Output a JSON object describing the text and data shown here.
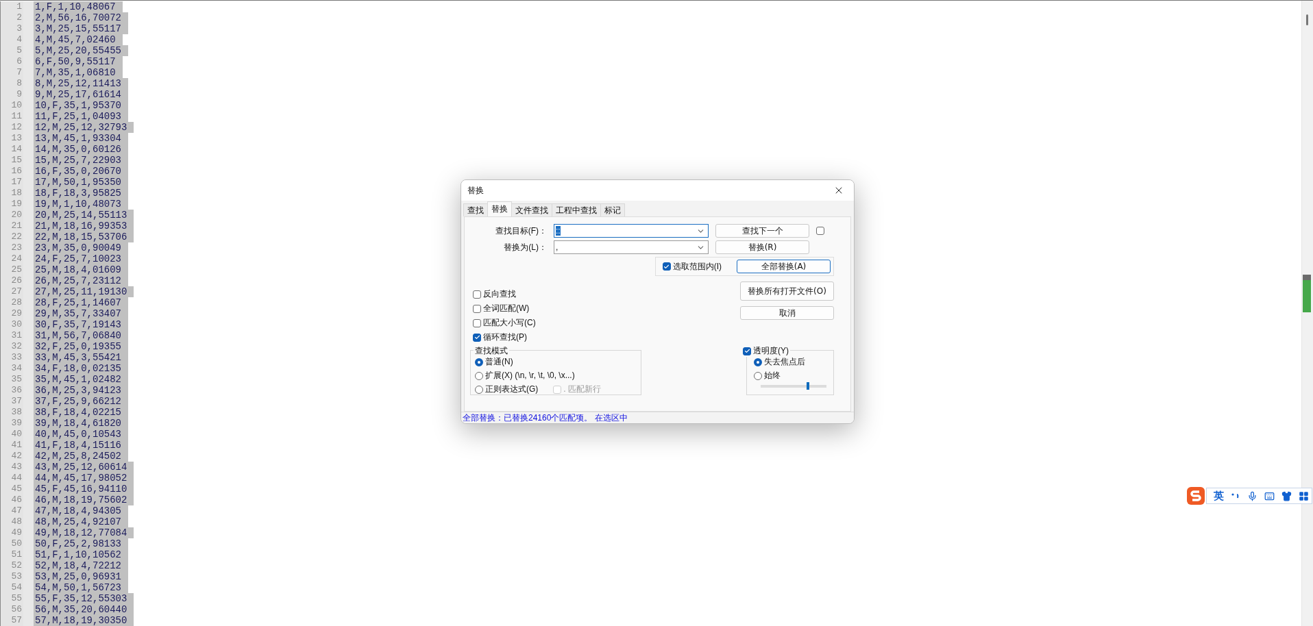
{
  "editor": {
    "selected": true,
    "lines": [
      {
        "number": "1",
        "text": "1,F,1,10,48067"
      },
      {
        "number": "2",
        "text": "2,M,56,16,70072"
      },
      {
        "number": "3",
        "text": "3,M,25,15,55117"
      },
      {
        "number": "4",
        "text": "4,M,45,7,02460"
      },
      {
        "number": "5",
        "text": "5,M,25,20,55455"
      },
      {
        "number": "6",
        "text": "6,F,50,9,55117"
      },
      {
        "number": "7",
        "text": "7,M,35,1,06810"
      },
      {
        "number": "8",
        "text": "8,M,25,12,11413"
      },
      {
        "number": "9",
        "text": "9,M,25,17,61614"
      },
      {
        "number": "10",
        "text": "10,F,35,1,95370"
      },
      {
        "number": "11",
        "text": "11,F,25,1,04093"
      },
      {
        "number": "12",
        "text": "12,M,25,12,32793"
      },
      {
        "number": "13",
        "text": "13,M,45,1,93304"
      },
      {
        "number": "14",
        "text": "14,M,35,0,60126"
      },
      {
        "number": "15",
        "text": "15,M,25,7,22903"
      },
      {
        "number": "16",
        "text": "16,F,35,0,20670"
      },
      {
        "number": "17",
        "text": "17,M,50,1,95350"
      },
      {
        "number": "18",
        "text": "18,F,18,3,95825"
      },
      {
        "number": "19",
        "text": "19,M,1,10,48073"
      },
      {
        "number": "20",
        "text": "20,M,25,14,55113"
      },
      {
        "number": "21",
        "text": "21,M,18,16,99353"
      },
      {
        "number": "22",
        "text": "22,M,18,15,53706"
      },
      {
        "number": "23",
        "text": "23,M,35,0,90049"
      },
      {
        "number": "24",
        "text": "24,F,25,7,10023"
      },
      {
        "number": "25",
        "text": "25,M,18,4,01609"
      },
      {
        "number": "26",
        "text": "26,M,25,7,23112"
      },
      {
        "number": "27",
        "text": "27,M,25,11,19130"
      },
      {
        "number": "28",
        "text": "28,F,25,1,14607"
      },
      {
        "number": "29",
        "text": "29,M,35,7,33407"
      },
      {
        "number": "30",
        "text": "30,F,35,7,19143"
      },
      {
        "number": "31",
        "text": "31,M,56,7,06840"
      },
      {
        "number": "32",
        "text": "32,F,25,0,19355"
      },
      {
        "number": "33",
        "text": "33,M,45,3,55421"
      },
      {
        "number": "34",
        "text": "34,F,18,0,02135"
      },
      {
        "number": "35",
        "text": "35,M,45,1,02482"
      },
      {
        "number": "36",
        "text": "36,M,25,3,94123"
      },
      {
        "number": "37",
        "text": "37,F,25,9,66212"
      },
      {
        "number": "38",
        "text": "38,F,18,4,02215"
      },
      {
        "number": "39",
        "text": "39,M,18,4,61820"
      },
      {
        "number": "40",
        "text": "40,M,45,0,10543"
      },
      {
        "number": "41",
        "text": "41,F,18,4,15116"
      },
      {
        "number": "42",
        "text": "42,M,25,8,24502"
      },
      {
        "number": "43",
        "text": "43,M,25,12,60614"
      },
      {
        "number": "44",
        "text": "44,M,45,17,98052"
      },
      {
        "number": "45",
        "text": "45,F,45,16,94110"
      },
      {
        "number": "46",
        "text": "46,M,18,19,75602"
      },
      {
        "number": "47",
        "text": "47,M,18,4,94305"
      },
      {
        "number": "48",
        "text": "48,M,25,4,92107"
      },
      {
        "number": "49",
        "text": "49,M,18,12,77084"
      },
      {
        "number": "50",
        "text": "50,F,25,2,98133"
      },
      {
        "number": "51",
        "text": "51,F,1,10,10562"
      },
      {
        "number": "52",
        "text": "52,M,18,4,72212"
      },
      {
        "number": "53",
        "text": "53,M,25,0,96931"
      },
      {
        "number": "54",
        "text": "54,M,50,1,56723"
      },
      {
        "number": "55",
        "text": "55,F,35,12,55303"
      },
      {
        "number": "56",
        "text": "56,M,35,20,60440"
      },
      {
        "number": "57",
        "text": "57,M,18,19,30350"
      }
    ]
  },
  "dialog": {
    "title": "替换",
    "tabs": [
      {
        "label": "查找",
        "selected": false
      },
      {
        "label": "替换",
        "selected": true
      },
      {
        "label": "文件查找",
        "selected": false
      },
      {
        "label": "工程中查找",
        "selected": false
      },
      {
        "label": "标记",
        "selected": false
      }
    ],
    "find": {
      "label": "查找目标(F)：",
      "value": "::",
      "value_highlighted": true
    },
    "replace": {
      "label": "替换为(L)：",
      "value": ","
    },
    "buttons": [
      {
        "label": "查找下一个",
        "default": false
      },
      {
        "label": "替换(R)",
        "default": false
      },
      {
        "label": "全部替换(A)",
        "default": true
      },
      {
        "label": "替换所有打开文件(O)",
        "default": false
      },
      {
        "label": "取消",
        "default": false
      }
    ],
    "find_next_option": {
      "checked": false
    },
    "in_selection": {
      "label": "选取范围内(I)",
      "checked": true
    },
    "options": [
      {
        "label": "反向查找",
        "checked": false
      },
      {
        "label": "全词匹配(W)",
        "checked": false
      },
      {
        "label": "匹配大小写(C)",
        "checked": false
      },
      {
        "label": "循环查找(P)",
        "checked": true
      }
    ],
    "search_mode": {
      "title": "查找模式",
      "modes": [
        {
          "label": "普通(N)",
          "selected": true
        },
        {
          "label": "扩展(X) (\\n, \\r, \\t, \\0, \\x...)",
          "selected": false
        },
        {
          "label": "正则表达式(G)",
          "selected": false
        }
      ],
      "newline": {
        "label": ". 匹配新行",
        "checked": false,
        "disabled": true
      }
    },
    "transparency": {
      "label": "透明度(Y)",
      "checked": true,
      "modes": [
        {
          "label": "失去焦点后",
          "selected": true
        },
        {
          "label": "始终",
          "selected": false
        }
      ],
      "level": 0.72
    },
    "status": "全部替换：已替换24160个匹配项。 在选区中"
  },
  "ime_toolbar": {
    "language": "英"
  }
}
